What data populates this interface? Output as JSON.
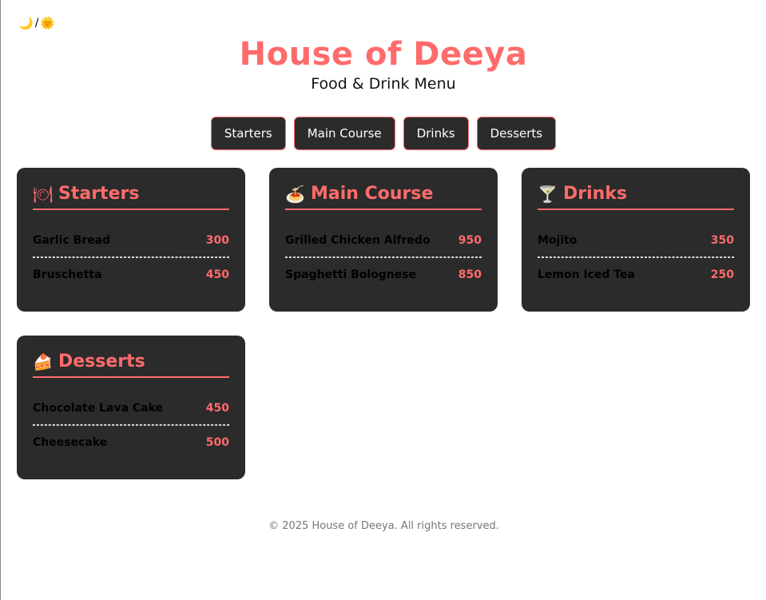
{
  "theme_toggle": {
    "moon": "🌙",
    "separator": "/",
    "sun": "🌞"
  },
  "header": {
    "title": "House of Deeya",
    "subtitle": "Food & Drink Menu"
  },
  "nav": [
    "Starters",
    "Main Course",
    "Drinks",
    "Desserts"
  ],
  "sections": [
    {
      "icon": "🍽",
      "icon_name": "plate-icon",
      "title": "Starters",
      "items": [
        {
          "name": "Garlic Bread",
          "price": "300"
        },
        {
          "name": "Bruschetta",
          "price": "450"
        }
      ]
    },
    {
      "icon": "🍝",
      "icon_name": "pasta-icon",
      "title": "Main Course",
      "items": [
        {
          "name": "Grilled Chicken Alfredo",
          "price": "950"
        },
        {
          "name": "Spaghetti Bolognese",
          "price": "850"
        }
      ]
    },
    {
      "icon": "🍸",
      "icon_name": "cocktail-icon",
      "title": "Drinks",
      "items": [
        {
          "name": "Mojito",
          "price": "350"
        },
        {
          "name": "Lemon Iced Tea",
          "price": "250"
        }
      ]
    },
    {
      "icon": "🍰",
      "icon_name": "cake-icon",
      "title": "Desserts",
      "items": [
        {
          "name": "Chocolate Lava Cake",
          "price": "450"
        },
        {
          "name": "Cheesecake",
          "price": "500"
        }
      ]
    }
  ],
  "footer": {
    "text": "© 2025 House of Deeya. All rights reserved."
  },
  "colors": {
    "accent": "#ff6b6b",
    "card_bg": "#2b2b2b"
  }
}
